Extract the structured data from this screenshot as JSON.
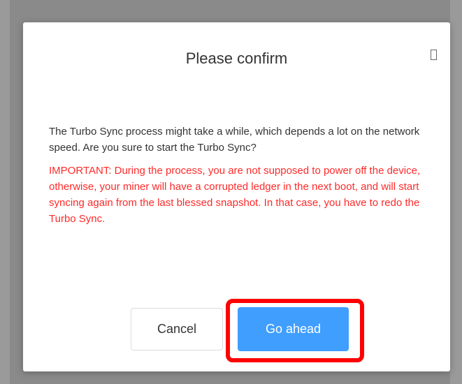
{
  "dialog": {
    "title": "Please confirm",
    "message": "The Turbo Sync process might take a while, which depends a lot on the network speed. Are you sure to start the Turbo Sync?",
    "warning": "IMPORTANT: During the process, you are not supposed to power off the device, otherwise, your miner will have a corrupted ledger in the next boot, and will start syncing again from the last blessed snapshot. In that case, you have to redo the Turbo Sync.",
    "close_icon": "close-icon",
    "cancel_label": "Cancel",
    "confirm_label": "Go ahead"
  },
  "colors": {
    "primary": "#409eff",
    "warning_text": "#ff2a2a",
    "highlight": "#ff0000",
    "overlay": "#8a8a8a"
  }
}
